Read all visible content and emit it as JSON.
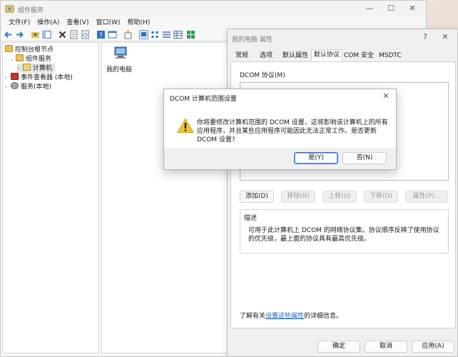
{
  "main_window": {
    "title": "组件服务",
    "menu": [
      "文件(F)",
      "操作(A)",
      "查看(V)",
      "窗口(W)",
      "帮助(H)"
    ],
    "tree": [
      {
        "label": "控制台根节点",
        "icon": "folder-icon"
      },
      {
        "label": "组件服务",
        "icon": "component-services-icon"
      },
      {
        "label": "计算机",
        "icon": "folder-icon"
      },
      {
        "label": "事件查看器 (本地)",
        "icon": "event-viewer-icon"
      },
      {
        "label": "服务(本地)",
        "icon": "services-gear-icon"
      }
    ],
    "content_item": {
      "label": "我的电脑",
      "icon": "computer-icon"
    }
  },
  "properties_dialog": {
    "title": "我的电脑 属性",
    "tabs": [
      "常规",
      "选项",
      "默认属性",
      "默认协议",
      "COM 安全",
      "MSDTC"
    ],
    "active_tab": 3,
    "protocols_label": "DCOM 协议(M)",
    "buttons": {
      "add": "添加(D)",
      "remove": "移除(R)",
      "up": "上移(U)",
      "down": "下移(O)",
      "properties": "属性(P)..."
    },
    "description_label": "描述",
    "description_text": "可用于此计算机上 DCOM 的网络协议集。协议顺序反映了使用协议的优先级，最上面的协议具有最高优先级。",
    "learn_more_prefix": "了解有关",
    "learn_more_link": "设置这些属性",
    "learn_more_suffix": "的详细信息。",
    "footer": {
      "ok": "确定",
      "cancel": "取消",
      "apply": "应用(A)"
    }
  },
  "alert_dialog": {
    "title": "DCOM 计算机范围设置",
    "message": "你将要修改计算机范围的 DCOM 设置，这将影响该计算机上的所有应用程序，并且某些应用程序可能因此无法正常工作。是否更新 DCOM 设置?",
    "yes": "是(Y)",
    "no": "否(N)"
  },
  "colors": {
    "accent": "#0b63c5",
    "warning": "#f4c430"
  }
}
